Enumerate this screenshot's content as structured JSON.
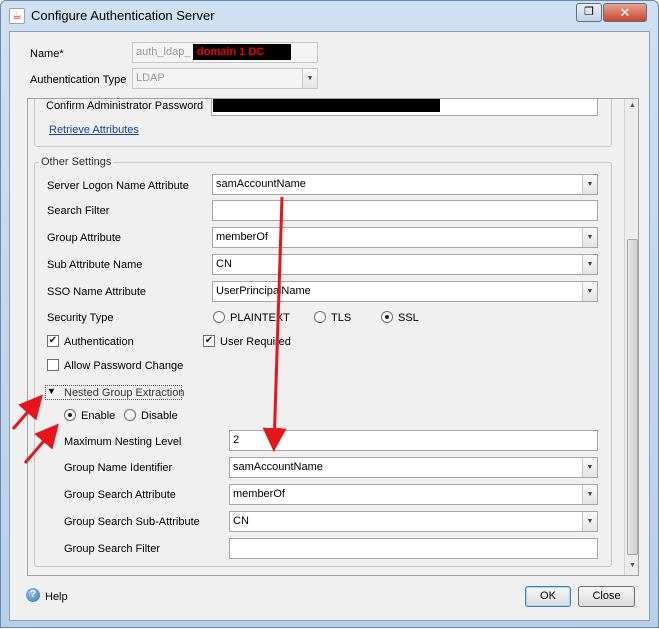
{
  "window": {
    "title": "Configure Authentication Server"
  },
  "top": {
    "name_label": "Name*",
    "name_value": "auth_ldap_",
    "name_redaction_overlay": "domain 1 DC",
    "auth_type_label": "Authentication Type",
    "auth_type_value": "LDAP"
  },
  "upper": {
    "confirm_pw_label": "Confirm Administrator Password",
    "retrieve_link": "Retrieve Attributes"
  },
  "other_settings": {
    "title": "Other Settings",
    "server_logon_label": "Server Logon Name Attribute",
    "server_logon_value": "samAccountName",
    "search_filter_label": "Search Filter",
    "search_filter_value": "",
    "group_attr_label": "Group Attribute",
    "group_attr_value": "memberOf",
    "sub_attr_label": "Sub Attribute Name",
    "sub_attr_value": "CN",
    "sso_label": "SSO Name Attribute",
    "sso_value": "UserPrincipalName",
    "security_type_label": "Security Type",
    "security_options": [
      "PLAINTEXT",
      "TLS",
      "SSL"
    ],
    "security_selected": "SSL",
    "authentication_label": "Authentication",
    "authentication_checked": true,
    "user_required_label": "User Required",
    "user_required_checked": true,
    "allow_pw_change_label": "Allow Password Change",
    "allow_pw_change_checked": false
  },
  "nested": {
    "title": "Nested Group Extraction",
    "enable_label": "Enable",
    "disable_label": "Disable",
    "selected": "Enable",
    "max_level_label": "Maximum Nesting Level",
    "max_level_value": "2",
    "group_name_id_label": "Group Name Identifier",
    "group_name_id_value": "samAccountName",
    "group_search_attr_label": "Group Search Attribute",
    "group_search_attr_value": "memberOf",
    "group_search_sub_label": "Group Search Sub-Attribute",
    "group_search_sub_value": "CN",
    "group_search_filter_label": "Group Search Filter",
    "group_search_filter_value": ""
  },
  "footer": {
    "help_label": "Help",
    "ok_label": "OK",
    "close_label": "Close"
  },
  "colors": {
    "annotation_red": "#e8141c",
    "link_blue": "#1a3fa6"
  }
}
